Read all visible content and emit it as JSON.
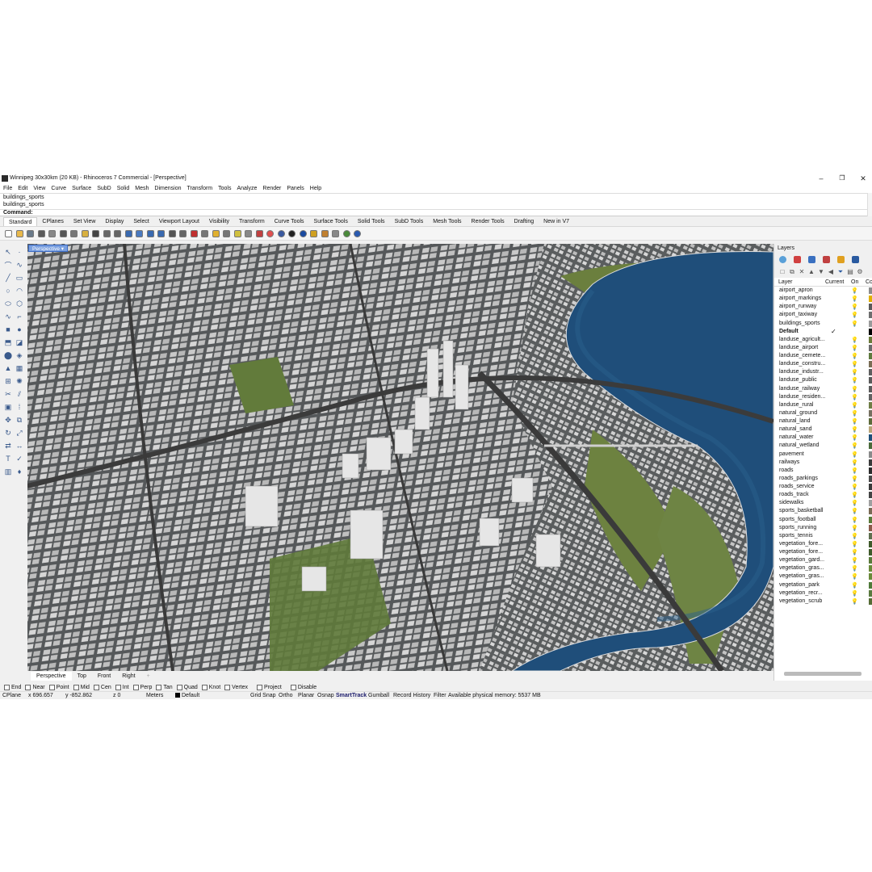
{
  "window": {
    "title": "Winnipeg 30x30km (20 KB) - Rhinoceros 7 Commercial - [Perspective]",
    "minimize": "–",
    "maximize": "❐",
    "close": "✕"
  },
  "menu": [
    "File",
    "Edit",
    "View",
    "Curve",
    "Surface",
    "SubD",
    "Solid",
    "Mesh",
    "Dimension",
    "Transform",
    "Tools",
    "Analyze",
    "Render",
    "Panels",
    "Help"
  ],
  "command_history": [
    "buildings_sports",
    "buildings_sports"
  ],
  "command_prompt": "Command:",
  "toolbar_tabs": [
    "Standard",
    "CPlanes",
    "Set View",
    "Display",
    "Select",
    "Viewport Layout",
    "Visibility",
    "Transform",
    "Curve Tools",
    "Surface Tools",
    "Solid Tools",
    "SubD Tools",
    "Mesh Tools",
    "Render Tools",
    "Drafting",
    "New in V7"
  ],
  "toolbar_icons": [
    "new-file-icon",
    "open-file-icon",
    "save-icon",
    "print-icon",
    "import-icon",
    "cut-icon",
    "copy-icon",
    "paste-icon",
    "undo-icon",
    "pan-icon",
    "move-icon",
    "zoom-icon",
    "zoom-window-icon",
    "zoom-extents-icon",
    "zoom-selected-icon",
    "rotate-view-icon",
    "grid-icon",
    "car-icon",
    "hide-icon",
    "named-view-icon",
    "snapshot-icon",
    "light-icon",
    "lock-icon",
    "layer-icon",
    "color-wheel-icon",
    "render-preview-icon",
    "material-icon",
    "render-icon",
    "sun-icon",
    "texture-icon",
    "select-points-icon",
    "grasshopper-icon",
    "help-icon"
  ],
  "viewport": {
    "label": "Perspective",
    "tabs": [
      "Perspective",
      "Top",
      "Front",
      "Right"
    ],
    "add_tab": "+"
  },
  "osnap": [
    "End",
    "Near",
    "Point",
    "Mid",
    "Cen",
    "Int",
    "Perp",
    "Tan",
    "Quad",
    "Knot",
    "Vertex",
    "Project",
    "Disable"
  ],
  "status": {
    "cplane": "CPlane",
    "x": "x 696.657",
    "y": "y -852.862",
    "z": "z 0",
    "units": "Meters",
    "layer": "Default",
    "grid_snap": "Grid Snap",
    "ortho": "Ortho",
    "planar": "Planar",
    "osnap": "Osnap",
    "smarttrack": "SmartTrack",
    "gumball": "Gumball",
    "record_history": "Record History",
    "filter": "Filter",
    "memory": "Available physical memory: 5537 MB"
  },
  "layers_panel": {
    "title": "Layers",
    "col_layer": "Layer",
    "col_current": "Current",
    "col_on": "On",
    "col_color": "Co",
    "current_mark": "✓",
    "on_icon": "💡",
    "rows": [
      {
        "name": "airport_apron",
        "color": "#8c8c8c"
      },
      {
        "name": "airport_markings",
        "color": "#e0b000"
      },
      {
        "name": "airport_runway",
        "color": "#5a5a5a"
      },
      {
        "name": "airport_taxiway",
        "color": "#6e6e6e"
      },
      {
        "name": "buildings_sports",
        "color": "#9a9a9a"
      },
      {
        "name": "Default",
        "color": "#000000",
        "current": true
      },
      {
        "name": "landuse_agricult...",
        "color": "#6b7a3a"
      },
      {
        "name": "landuse_airport",
        "color": "#6b6b6b"
      },
      {
        "name": "landuse_cemete...",
        "color": "#5f7a3f"
      },
      {
        "name": "landuse_constru...",
        "color": "#7a6d55"
      },
      {
        "name": "landuse_industr...",
        "color": "#5e5e5e"
      },
      {
        "name": "landuse_public",
        "color": "#5a5a5a"
      },
      {
        "name": "landuse_railway",
        "color": "#5c5c5c"
      },
      {
        "name": "landuse_residen...",
        "color": "#626262"
      },
      {
        "name": "landuse_rural",
        "color": "#6f7d46"
      },
      {
        "name": "natural_ground",
        "color": "#767060"
      },
      {
        "name": "natural_land",
        "color": "#5c6a3a"
      },
      {
        "name": "natural_sand",
        "color": "#b9a67a"
      },
      {
        "name": "natural_water",
        "color": "#1e4f7a"
      },
      {
        "name": "natural_wetland",
        "color": "#4a6a3a"
      },
      {
        "name": "pavement",
        "color": "#8a8a8a"
      },
      {
        "name": "railways",
        "color": "#3a3a3a"
      },
      {
        "name": "roads",
        "color": "#2c2c2c"
      },
      {
        "name": "roads_parkings",
        "color": "#4a4a4a"
      },
      {
        "name": "roads_service",
        "color": "#3a3a3a"
      },
      {
        "name": "roads_track",
        "color": "#444444"
      },
      {
        "name": "sidewalks",
        "color": "#a0a0a0"
      },
      {
        "name": "sports_basketball",
        "color": "#7a6a55"
      },
      {
        "name": "sports_football",
        "color": "#5a7a3a"
      },
      {
        "name": "sports_running",
        "color": "#8a5a4a"
      },
      {
        "name": "sports_tennis",
        "color": "#5f6f4f"
      },
      {
        "name": "vegetation_fore...",
        "color": "#3f5a2a"
      },
      {
        "name": "vegetation_fore...",
        "color": "#3f5a2a"
      },
      {
        "name": "vegetation_gard...",
        "color": "#5a7a3a"
      },
      {
        "name": "vegetation_gras...",
        "color": "#6a8a3a"
      },
      {
        "name": "vegetation_gras...",
        "color": "#6a8a3a"
      },
      {
        "name": "vegetation_park",
        "color": "#4f7a3a"
      },
      {
        "name": "vegetation_recr...",
        "color": "#5a7a3f"
      },
      {
        "name": "vegetation_scrub",
        "color": "#556b35"
      }
    ]
  },
  "colors": {
    "accent": "#7aa0e0",
    "water": "#1f4e7a",
    "grass": "#5f7a3a",
    "ground": "#6b6e6c"
  }
}
